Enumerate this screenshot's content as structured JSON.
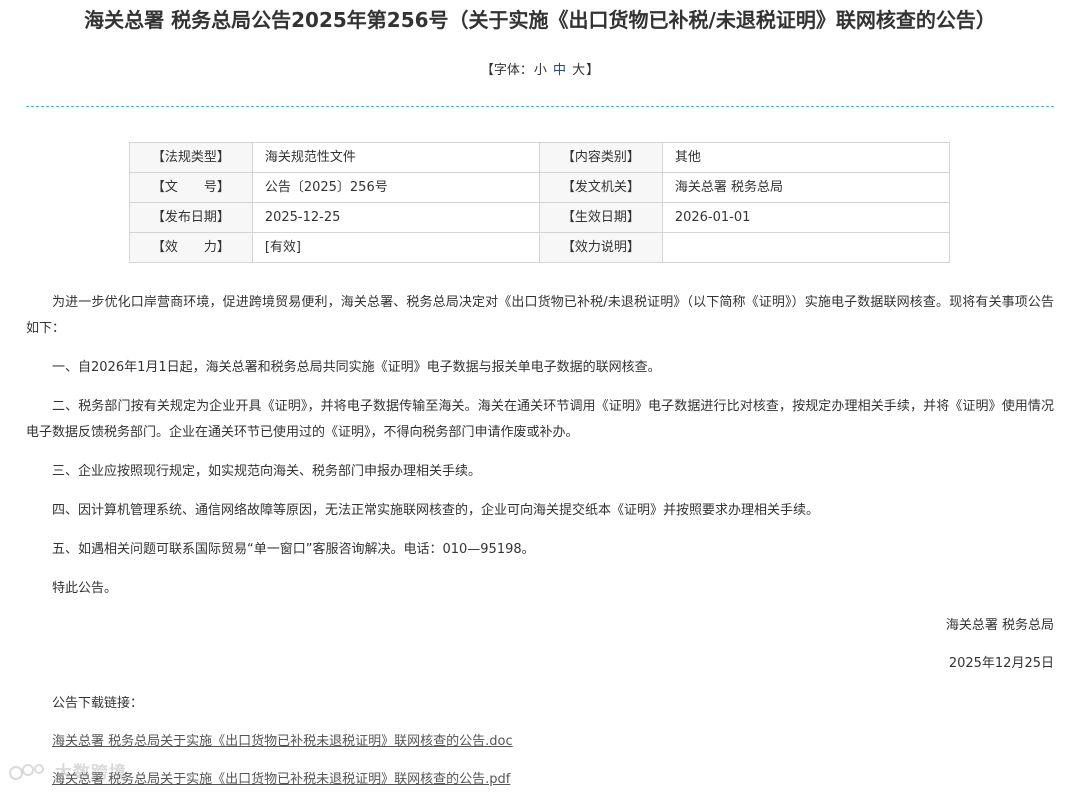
{
  "title": "海关总署 税务总局公告2025年第256号（关于实施《出口货物已补税/未退税证明》联网核查的公告）",
  "font_size_bar": {
    "prefix": "【字体：",
    "small": "小",
    "medium": "中",
    "large": "大",
    "suffix": "】"
  },
  "meta": {
    "rows": [
      {
        "label1": "【法规类型】",
        "value1": "海关规范性文件",
        "label2": "【内容类别】",
        "value2": "其他"
      },
      {
        "label1": "【文　　号】",
        "value1": "公告〔2025〕256号",
        "label2": "【发文机关】",
        "value2": "海关总署 税务总局"
      },
      {
        "label1": "【发布日期】",
        "value1": "2025-12-25",
        "label2": "【生效日期】",
        "value2": "2026-01-01"
      },
      {
        "label1": "【效　　力】",
        "value1": "[有效]",
        "label2": "【效力说明】",
        "value2": ""
      }
    ]
  },
  "body": {
    "paragraphs": [
      "为进一步优化口岸营商环境，促进跨境贸易便利，海关总署、税务总局决定对《出口货物已补税/未退税证明》（以下简称《证明》）实施电子数据联网核查。现将有关事项公告如下：",
      "一、自2026年1月1日起，海关总署和税务总局共同实施《证明》电子数据与报关单电子数据的联网核查。",
      "二、税务部门按有关规定为企业开具《证明》，并将电子数据传输至海关。海关在通关环节调用《证明》电子数据进行比对核查，按规定办理相关手续，并将《证明》使用情况电子数据反馈税务部门。企业在通关环节已使用过的《证明》，不得向税务部门申请作废或补办。",
      "三、企业应按照现行规定，如实规范向海关、税务部门申报办理相关手续。",
      "四、因计算机管理系统、通信网络故障等原因，无法正常实施联网核查的，企业可向海关提交纸本《证明》并按照要求办理相关手续。",
      "五、如遇相关问题可联系国际贸易“单一窗口”客服咨询解决。电话：010—95198。",
      "特此公告。"
    ]
  },
  "signature": {
    "issuer": "海关总署 税务总局",
    "date": "2025年12月25日"
  },
  "downloads": {
    "label": "公告下载链接：",
    "links": [
      "海关总署 税务总局关于实施《出口货物已补税未退税证明》联网核查的公告.doc",
      "海关总署 税务总局关于实施《出口货物已补税未退税证明》联网核查的公告.pdf"
    ]
  },
  "watermark": {
    "text": "大数跨境"
  },
  "colors": {
    "divider": "#4cb7c8",
    "text": "#333333",
    "link": "#555555"
  }
}
